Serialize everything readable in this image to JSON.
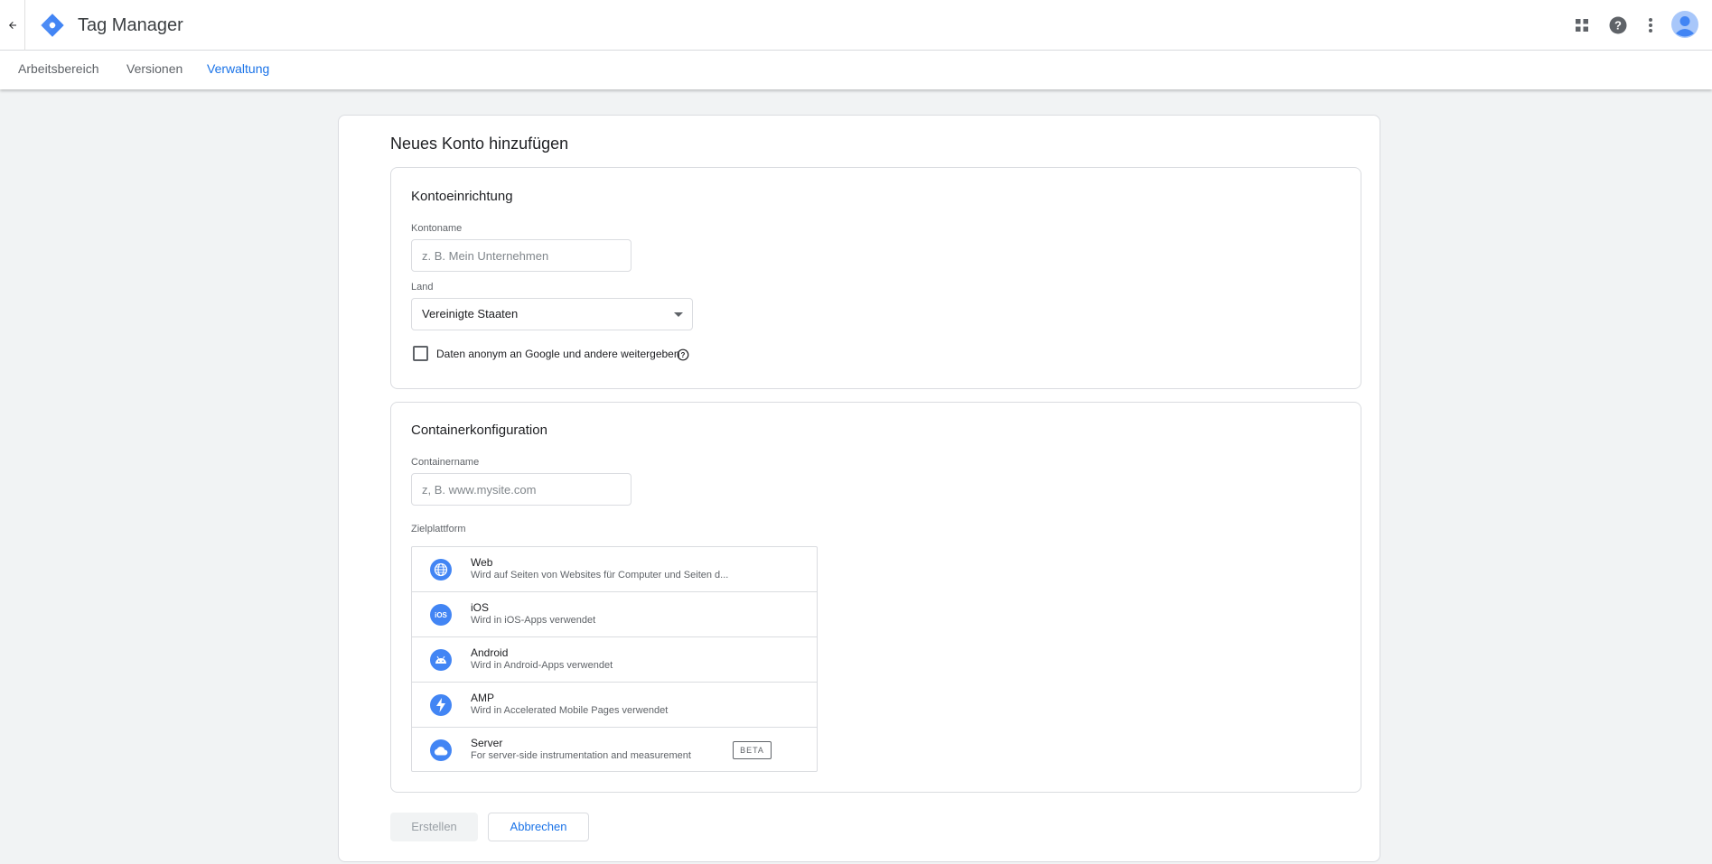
{
  "header": {
    "app_title": "Tag Manager",
    "icons": [
      "back-arrow-icon",
      "tag-manager-logo",
      "apps-grid-icon",
      "help-icon",
      "more-vert-icon",
      "account-avatar-icon"
    ]
  },
  "nav": {
    "tabs": [
      {
        "label": "Arbeitsbereich",
        "active": false
      },
      {
        "label": "Versionen",
        "active": false
      },
      {
        "label": "Verwaltung",
        "active": true
      }
    ]
  },
  "form": {
    "title": "Neues Konto hinzufügen",
    "account_setup": {
      "title": "Kontoeinrichtung",
      "account_name_label": "Kontoname",
      "account_name_placeholder": "z. B. Mein Unternehmen",
      "account_name_value": "",
      "country_label": "Land",
      "country_value": "Vereinigte Staaten",
      "share_data_label": "Daten anonym an Google und andere weitergeben",
      "share_data_checked": false
    },
    "container_setup": {
      "title": "Containerkonfiguration",
      "container_name_label": "Containername",
      "container_name_placeholder": "z, B. www.mysite.com",
      "container_name_value": "",
      "target_platform_label": "Zielplattform",
      "platforms": [
        {
          "name": "Web",
          "description": "Wird auf Seiten von Websites für Computer und Seiten d...",
          "icon": "globe-icon"
        },
        {
          "name": "iOS",
          "description": "Wird in iOS-Apps verwendet",
          "icon": "ios-icon"
        },
        {
          "name": "Android",
          "description": "Wird in Android-Apps verwendet",
          "icon": "android-icon"
        },
        {
          "name": "AMP",
          "description": "Wird in Accelerated Mobile Pages verwendet",
          "icon": "amp-bolt-icon"
        },
        {
          "name": "Server",
          "description": "For server-side instrumentation and measurement",
          "icon": "cloud-icon",
          "badge": "BETA"
        }
      ]
    },
    "buttons": {
      "create": "Erstellen",
      "cancel": "Abbrechen"
    }
  },
  "colors": {
    "accent": "#1a73e8",
    "platform_icon": "#4285f4",
    "background": "#f1f3f4"
  }
}
